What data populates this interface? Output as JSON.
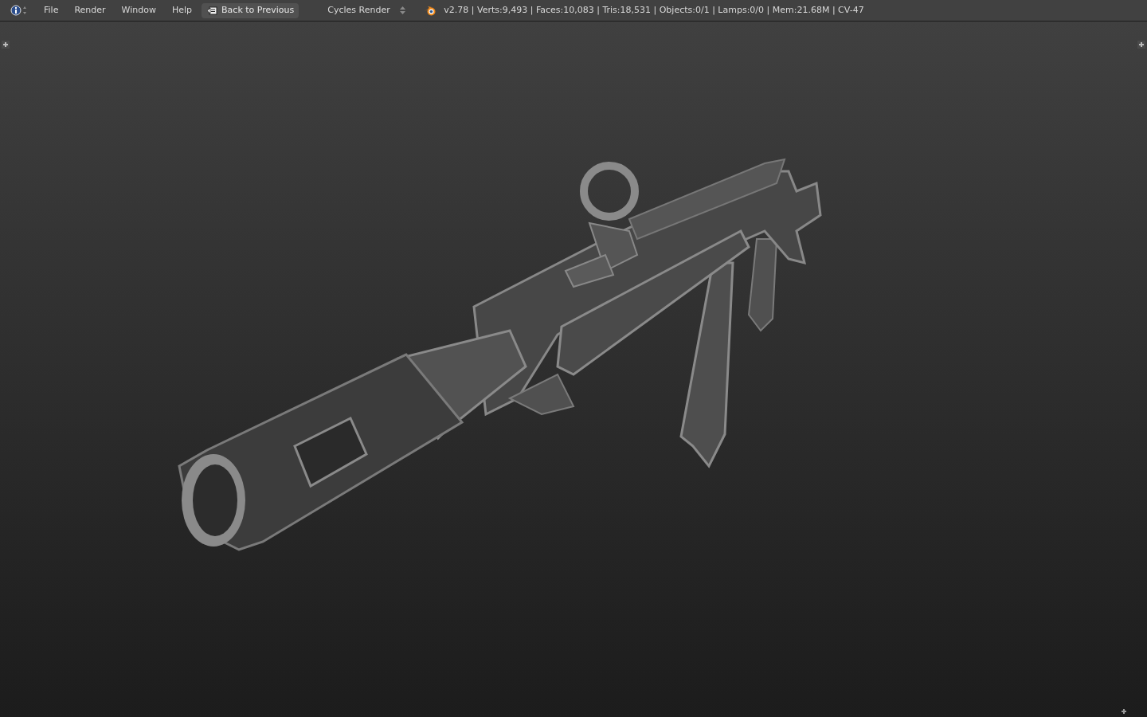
{
  "header": {
    "menus": [
      "File",
      "Render",
      "Window",
      "Help"
    ],
    "back_button": {
      "label": "Back to Previous"
    },
    "render_engine": {
      "value": "Cycles Render"
    },
    "stats": "v2.78 | Verts:9,493 | Faces:10,083 | Tris:18,531 | Objects:0/1 | Lamps:0/0 | Mem:21.68M | CV-47"
  }
}
